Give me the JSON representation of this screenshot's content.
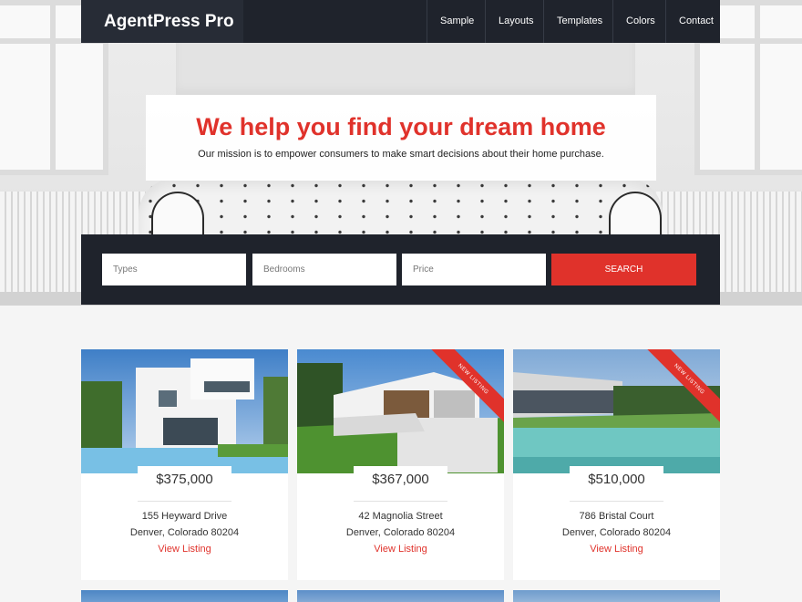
{
  "site": {
    "title": "AgentPress Pro"
  },
  "nav": {
    "items": [
      "Sample",
      "Layouts",
      "Templates",
      "Colors",
      "Contact"
    ]
  },
  "intro": {
    "title": "We help you find your dream home",
    "subtitle": "Our mission is to empower consumers to make smart decisions about their home purchase."
  },
  "search": {
    "types_placeholder": "Types",
    "bedrooms_placeholder": "Bedrooms",
    "price_placeholder": "Price",
    "button_label": "SEARCH"
  },
  "listings": [
    {
      "price": "$375,000",
      "address": "155 Heyward Drive",
      "city": "Denver, Colorado 80204",
      "link": "View Listing",
      "ribbon": ""
    },
    {
      "price": "$367,000",
      "address": "42 Magnolia Street",
      "city": "Denver, Colorado 80204",
      "link": "View Listing",
      "ribbon": "NEW LISTING"
    },
    {
      "price": "$510,000",
      "address": "786 Bristal Court",
      "city": "Denver, Colorado 80204",
      "link": "View Listing",
      "ribbon": "NEW LISTING"
    }
  ],
  "colors": {
    "accent": "#e0322b",
    "dark": "#1f232c"
  }
}
